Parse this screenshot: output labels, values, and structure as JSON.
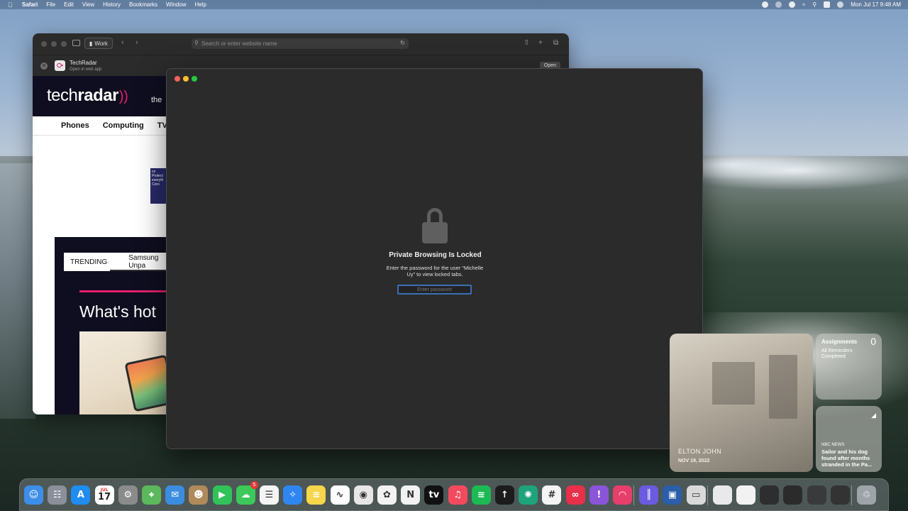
{
  "menubar": {
    "app_name": "Safari",
    "menus": [
      "File",
      "Edit",
      "View",
      "History",
      "Bookmarks",
      "Window",
      "Help"
    ],
    "clock": "Mon Jul 17  9:48 AM"
  },
  "safari": {
    "profile": "Work",
    "address_placeholder": "Search or enter website name",
    "banner": {
      "title": "TechRadar",
      "subtitle": "Open in web app",
      "open_label": "Open"
    },
    "site": {
      "logo_light": "tech",
      "logo_bold": "radar",
      "tagline": "the",
      "nav": [
        "Phones",
        "Computing",
        "TVs"
      ],
      "ad_text": "co Protect everyth Coro",
      "trending_label": "TRENDING",
      "trending_item": "Samsung Unpa",
      "whats_hot": "What's hot"
    }
  },
  "private_window": {
    "title": "Private Browsing Is Locked",
    "description": "Enter the password for the user “Michelle Uy” to view locked tabs.",
    "password_placeholder": "Enter password"
  },
  "widgets": {
    "photo": {
      "caption": "ELTON JOHN",
      "date": "NOV 19, 2022"
    },
    "reminders": {
      "title": "Assignments",
      "count": "0",
      "status": "All Reminders Completed"
    },
    "news": {
      "source": "NBC NEWS",
      "headline": "Sailor and his dog found after months stranded in the Pa..."
    }
  },
  "dock": {
    "messages_badge": "5",
    "calendar_month": "JUL",
    "calendar_day": "17",
    "apps": [
      {
        "name": "finder",
        "color": "#3d8ee8",
        "glyph": "☺"
      },
      {
        "name": "launchpad",
        "color": "#8a8f99",
        "glyph": "☷"
      },
      {
        "name": "app-store",
        "color": "#1f8cf0",
        "glyph": "A"
      },
      {
        "name": "calendar",
        "color": "#ffffff",
        "glyph": ""
      },
      {
        "name": "system-settings",
        "color": "#8b8b8b",
        "glyph": "⚙"
      },
      {
        "name": "maps",
        "color": "#5cb85c",
        "glyph": "⌖"
      },
      {
        "name": "mail",
        "color": "#3b8de0",
        "glyph": "✉"
      },
      {
        "name": "contacts",
        "color": "#b08a5a",
        "glyph": "☻"
      },
      {
        "name": "facetime",
        "color": "#32c25a",
        "glyph": "▶"
      },
      {
        "name": "messages",
        "color": "#3dc85a",
        "glyph": "☁"
      },
      {
        "name": "reminders",
        "color": "#f4f4f4",
        "glyph": "☰"
      },
      {
        "name": "safari",
        "color": "#2f86f0",
        "glyph": "✧"
      },
      {
        "name": "notes",
        "color": "#f6d64a",
        "glyph": "≡"
      },
      {
        "name": "freeform",
        "color": "#ffffff",
        "glyph": "∿"
      },
      {
        "name": "chrome",
        "color": "#e6e6e6",
        "glyph": "◉"
      },
      {
        "name": "photos",
        "color": "#f2f2f2",
        "glyph": "✿"
      },
      {
        "name": "news",
        "color": "#f2f2f2",
        "glyph": "N"
      },
      {
        "name": "apple-tv",
        "color": "#111111",
        "glyph": "tv"
      },
      {
        "name": "music",
        "color": "#f44a5e",
        "glyph": "♫"
      },
      {
        "name": "spotify",
        "color": "#1db954",
        "glyph": "≋"
      },
      {
        "name": "app-yellow-green",
        "color": "#1c1c1c",
        "glyph": "↑"
      },
      {
        "name": "chatgpt",
        "color": "#1fa37b",
        "glyph": "✺"
      },
      {
        "name": "slack",
        "color": "#f4f4f4",
        "glyph": "#"
      },
      {
        "name": "creative-cloud",
        "color": "#e8304a",
        "glyph": "∞"
      },
      {
        "name": "feedback",
        "color": "#8a55d8",
        "glyph": "!"
      },
      {
        "name": "rss-app",
        "color": "#e83e6b",
        "glyph": "◠"
      },
      {
        "name": "voice-memos",
        "color": "#6a5be0",
        "glyph": "║"
      },
      {
        "name": "preview",
        "color": "#2a5ea8",
        "glyph": "▣"
      },
      {
        "name": "screen-sharing",
        "color": "#d9d9d9",
        "glyph": "▭"
      },
      {
        "name": "window-thumb-1",
        "color": "#e9e9e9",
        "glyph": ""
      },
      {
        "name": "window-thumb-2",
        "color": "#f2f2f2",
        "glyph": ""
      },
      {
        "name": "window-thumb-3",
        "color": "#2e2e2e",
        "glyph": ""
      },
      {
        "name": "window-thumb-4",
        "color": "#2b2b2b",
        "glyph": ""
      },
      {
        "name": "window-thumb-5",
        "color": "#3a3a3a",
        "glyph": ""
      },
      {
        "name": "window-thumb-6",
        "color": "#333333",
        "glyph": ""
      },
      {
        "name": "trash",
        "color": "#9ea3a8",
        "glyph": "♲"
      }
    ]
  },
  "colors": {
    "accent_pink": "#e4206a",
    "focus_blue": "#3b6fb6",
    "traffic_red": "#fe5f57",
    "traffic_yellow": "#febc2e",
    "traffic_green": "#28c840"
  }
}
